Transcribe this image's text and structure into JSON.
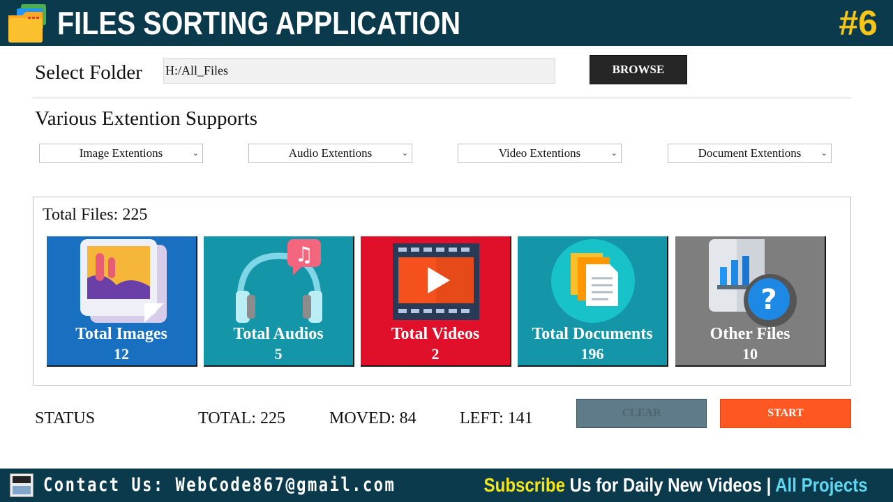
{
  "banner": {
    "title": "FILES SORTING APPLICATION",
    "episode": "#6"
  },
  "folder": {
    "label": "Select Folder",
    "path": "H:/All_Files",
    "browse_label": "BROWSE"
  },
  "extensions": {
    "label": "Various Extention Supports",
    "selects": [
      {
        "selected": "Image Extentions"
      },
      {
        "selected": "Audio Extentions"
      },
      {
        "selected": "Video Extentions"
      },
      {
        "selected": "Document Extentions"
      }
    ]
  },
  "stats": {
    "total_files_label": "Total Files: 225",
    "cards": [
      {
        "title": "Total Images",
        "count": "12",
        "color": "#1a70c0"
      },
      {
        "title": "Total Audios",
        "count": "5",
        "color": "#1595a8"
      },
      {
        "title": "Total Videos",
        "count": "2",
        "color": "#e0102a"
      },
      {
        "title": "Total Documents",
        "count": "196",
        "color": "#1595a8"
      },
      {
        "title": "Other Files",
        "count": "10",
        "color": "#7e7e7e"
      }
    ]
  },
  "status_row": {
    "label": "STATUS",
    "total": "TOTAL: 225",
    "moved": "MOVED: 84",
    "left": "LEFT: 141",
    "clear_label": "CLEAR",
    "start_label": "START"
  },
  "footer": {
    "contact": "Contact Us: WebCode867@gmail.com",
    "subscribe": "Subscribe",
    "daily": " Us for Daily New Videos | ",
    "projects": "All Projects"
  }
}
